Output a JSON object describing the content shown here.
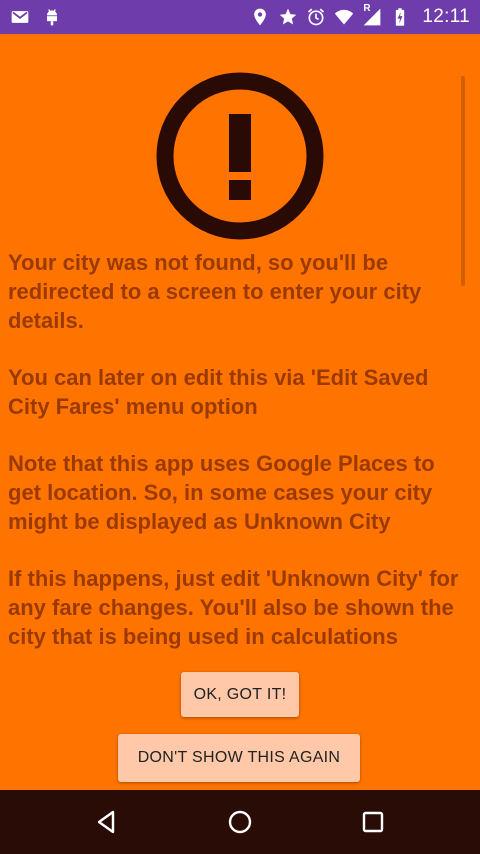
{
  "status_bar": {
    "time": "12:11",
    "left_icons": [
      "gmail-icon",
      "android-debug-icon"
    ],
    "right_icons": [
      "location-icon",
      "star-icon",
      "alarm-icon",
      "wifi-icon",
      "signal-icon",
      "battery-charging-icon"
    ],
    "signal_roaming_label": "R",
    "background_color": "#6f3cac"
  },
  "dialog": {
    "icon": "exclamation-circle-icon",
    "background_color": "#ff7400",
    "text_color": "#9b3a00",
    "paragraphs": [
      "Your city was not found, so you'll be redirected to a screen to enter your city details.",
      "You can later on edit this via 'Edit Saved City Fares' menu option",
      "Note that this app uses Google Places to get location. So, in some cases your city might be displayed as Unknown City",
      "If this happens, just edit 'Unknown City' for any fare changes. You'll also be shown the city that is being used in calculations"
    ],
    "ok_button_label": "OK, GOT IT!",
    "dont_show_button_label": "DON'T SHOW THIS AGAIN"
  },
  "nav_bar": {
    "buttons": [
      "back-icon",
      "home-icon",
      "recents-icon"
    ]
  }
}
